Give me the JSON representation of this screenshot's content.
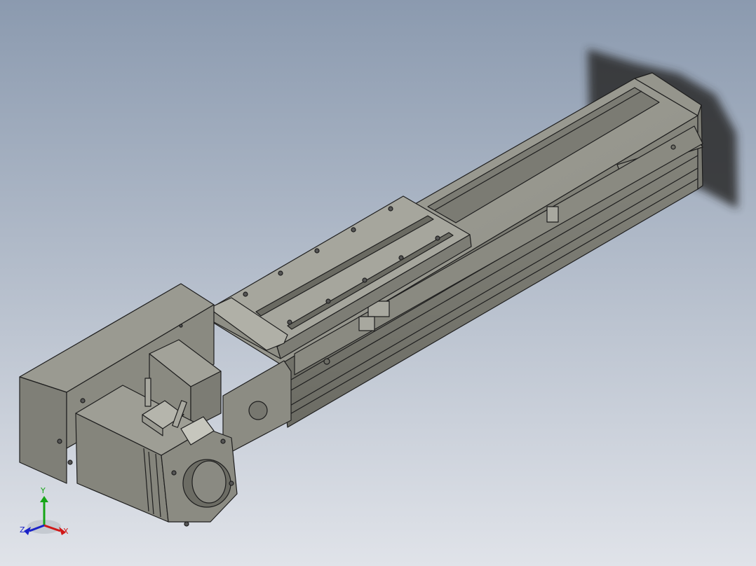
{
  "viewport": {
    "background_top": "#8b9aaf",
    "background_bottom": "#dfe3ea",
    "model_fill": "#8f8f86",
    "model_edge": "#1e1e1e"
  },
  "axes_triad": {
    "x_label": "X",
    "y_label": "Y",
    "z_label": "Z",
    "x_color": "#d01818",
    "y_color": "#16a516",
    "z_color": "#1a22c8"
  }
}
